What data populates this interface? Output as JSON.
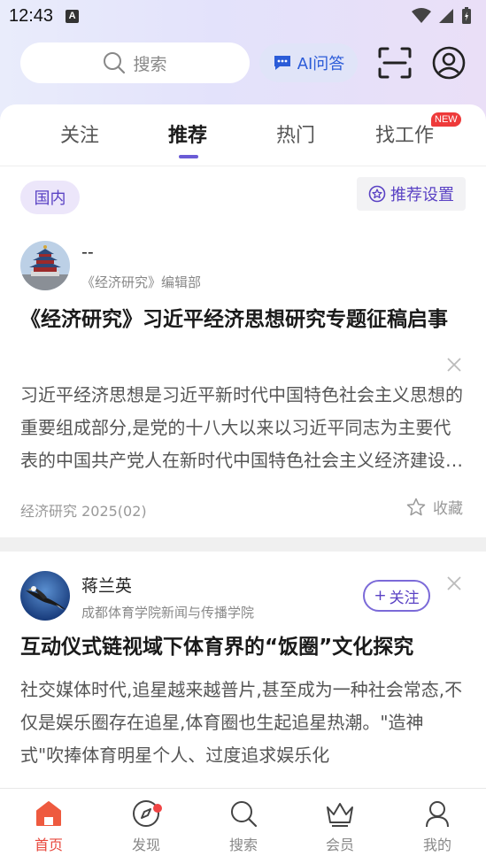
{
  "status_bar": {
    "time": "12:43",
    "notif_icon": "A"
  },
  "header": {
    "search_placeholder": "搜索",
    "ai_label": "AI问答"
  },
  "tabs": [
    {
      "label": "关注"
    },
    {
      "label": "推荐",
      "active": true
    },
    {
      "label": "热门"
    },
    {
      "label": "找工作",
      "badge": "NEW"
    }
  ],
  "filter": {
    "region_chip": "国内",
    "settings_label": "推荐设置"
  },
  "articles": [
    {
      "author": "--",
      "org": "《经济研究》编辑部",
      "title": "《经济研究》习近平经济思想研究专题征稿启事",
      "summary": "习近平经济思想是习近平新时代中国特色社会主义思想的重要组成部分,是党的十八大以来以习近平同志为主要代表的中国共产党人在新时代中国特色社会主义经济建设实践中形成的",
      "source": "经济研究 2025(02)",
      "fav_label": "收藏"
    },
    {
      "author": "蒋兰英",
      "org": "成都体育学院新闻与传播学院",
      "follow_label": "关注",
      "title": "互动仪式链视域下体育界的“饭圈”文化探究",
      "summary": "社交媒体时代,追星越来越普片,甚至成为一种社会常态,不仅是娱乐圈存在追星,体育圈也生起追星热潮。\"造神式\"吹捧体育明星个人、过度追求娱乐化"
    }
  ],
  "bottom_nav": [
    {
      "label": "首页",
      "icon": "home-icon",
      "active": true
    },
    {
      "label": "发现",
      "icon": "compass-icon",
      "dot": true
    },
    {
      "label": "搜索",
      "icon": "search-icon"
    },
    {
      "label": "会员",
      "icon": "crown-icon"
    },
    {
      "label": "我的",
      "icon": "user-icon"
    }
  ],
  "colors": {
    "accent": "#5a42c4",
    "nav_active": "#e8483d",
    "ai_blue": "#2b5bd8"
  }
}
